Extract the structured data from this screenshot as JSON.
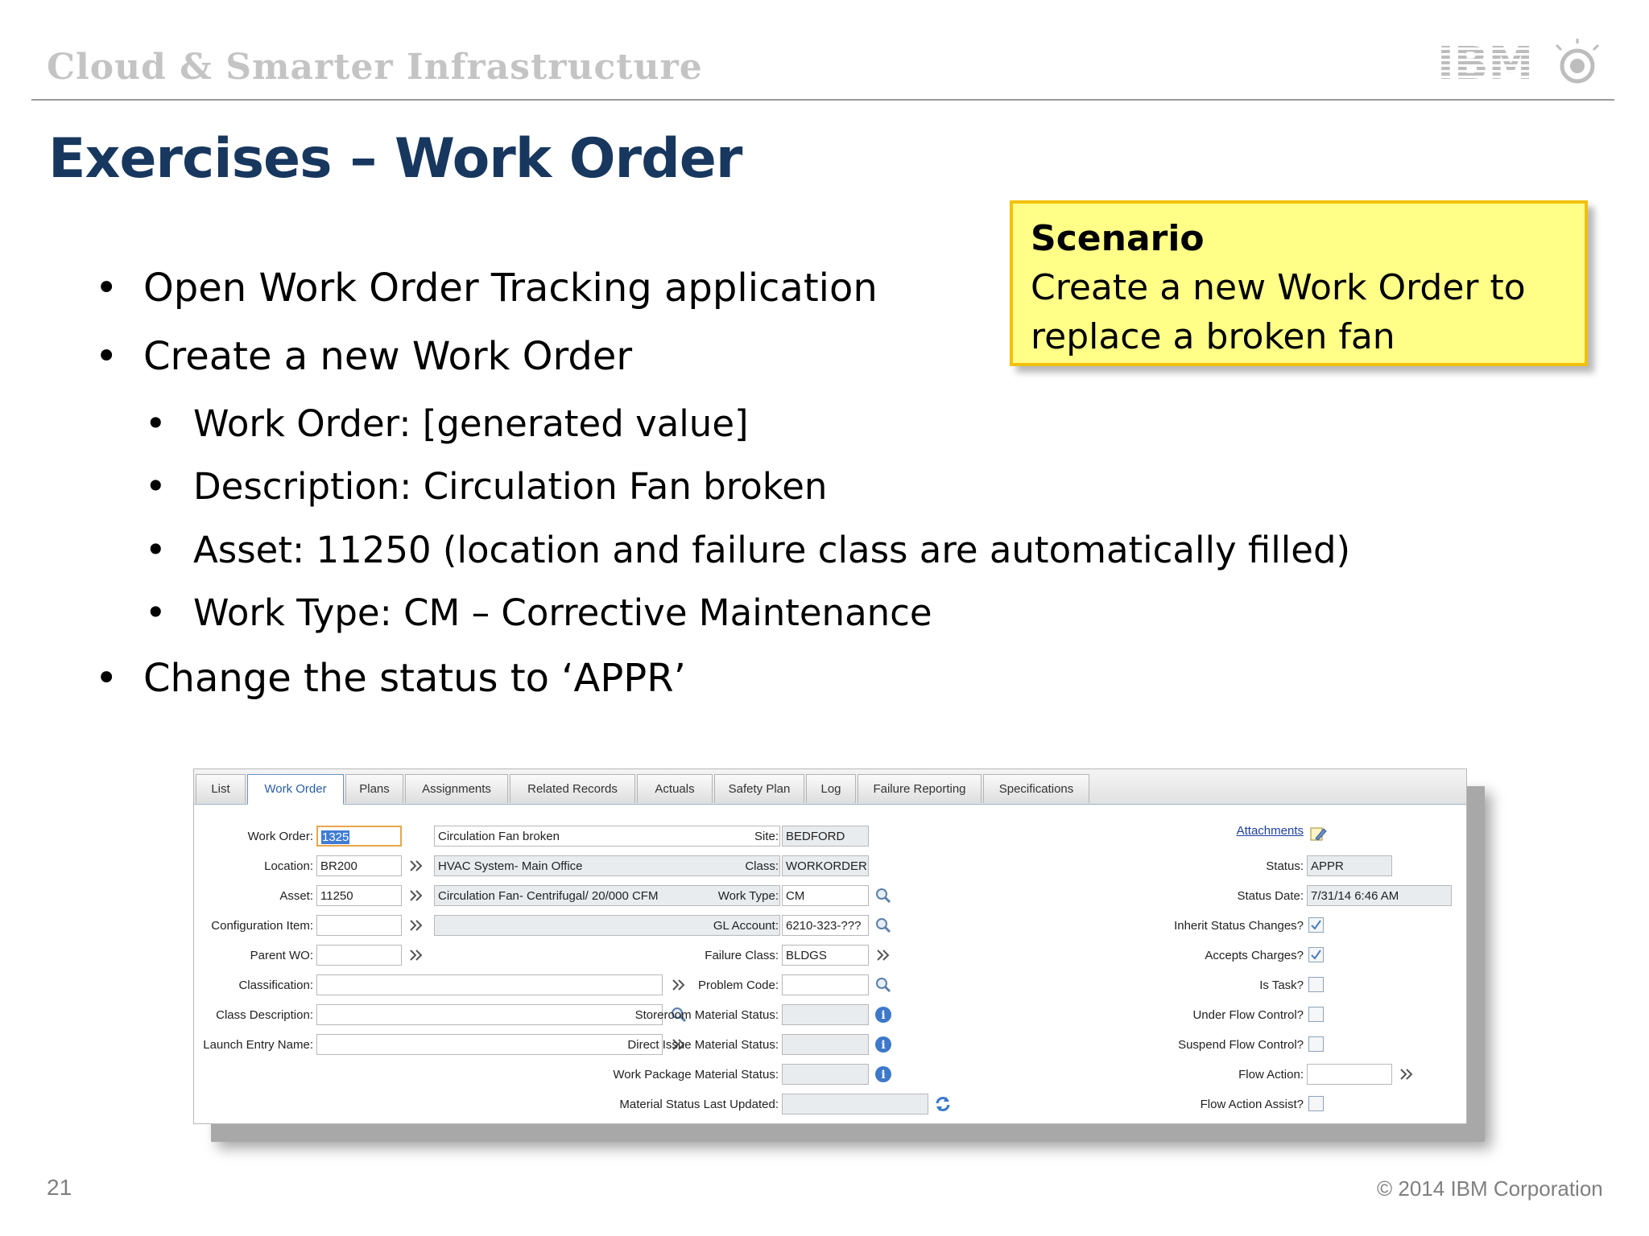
{
  "header": {
    "title": "Cloud & Smarter Infrastructure",
    "logo_text": "IBM"
  },
  "slide": {
    "title": "Exercises – Work Order",
    "bullets": [
      "Open Work Order Tracking application",
      "Create a new Work Order",
      "Work Order: [generated value]",
      "Description: Circulation Fan broken",
      "Asset: 11250 (location and failure class are automatically filled)",
      "Work Type: CM – Corrective Maintenance",
      "Change the status to ‘APPR’"
    ]
  },
  "scenario": {
    "title": "Scenario",
    "line1": "Create a new Work Order to",
    "line2": "replace a broken fan"
  },
  "app": {
    "tabs": [
      "List",
      "Work Order",
      "Plans",
      "Assignments",
      "Related Records",
      "Actuals",
      "Safety Plan",
      "Log",
      "Failure Reporting",
      "Specifications"
    ],
    "active_tab": "Work Order",
    "labels": {
      "work_order": "Work Order:",
      "location": "Location:",
      "asset": "Asset:",
      "configuration_item": "Configuration Item:",
      "parent_wo": "Parent WO:",
      "classification": "Classification:",
      "class_description": "Class Description:",
      "launch_entry_name": "Launch Entry Name:",
      "site": "Site:",
      "class": "Class:",
      "work_type": "Work Type:",
      "gl_account": "GL Account:",
      "failure_class": "Failure Class:",
      "problem_code": "Problem Code:",
      "storeroom_material_status": "Storeroom Material Status:",
      "direct_issue_material_status": "Direct Issue Material Status:",
      "work_package_material_status": "Work Package Material Status:",
      "material_status_last_updated": "Material Status Last Updated:",
      "attachments": "Attachments",
      "status": "Status:",
      "status_date": "Status Date:",
      "inherit_status_changes": "Inherit Status Changes?",
      "accepts_charges": "Accepts Charges?",
      "is_task": "Is Task?",
      "under_flow_control": "Under Flow Control?",
      "suspend_flow_control": "Suspend Flow Control?",
      "flow_action": "Flow Action:",
      "flow_action_assist": "Flow Action Assist?"
    },
    "values": {
      "work_order": "1325",
      "description": "Circulation Fan broken",
      "location": "BR200",
      "location_desc": "HVAC System- Main Office",
      "asset": "11250",
      "asset_desc": "Circulation Fan- Centrifugal/ 20/000 CFM",
      "configuration_item": "",
      "config_desc": "",
      "parent_wo": "",
      "classification": "",
      "class_description": "",
      "launch_entry_name": "",
      "site": "BEDFORD",
      "class": "WORKORDER",
      "work_type": "CM",
      "gl_account": "6210-323-???",
      "failure_class": "BLDGS",
      "problem_code": "",
      "storeroom_material_status": "",
      "direct_issue_material_status": "",
      "work_package_material_status": "",
      "material_status_last_updated": "",
      "status": "APPR",
      "status_date": "7/31/14 6:46 AM",
      "flow_action": "",
      "inherit_status_changes": true,
      "accepts_charges": true,
      "is_task": false,
      "under_flow_control": false,
      "suspend_flow_control": false,
      "flow_action_assist": false
    }
  },
  "footer": {
    "page_number": "21",
    "copyright": "© 2014 IBM Corporation"
  },
  "colors": {
    "title": "#17375e",
    "scenario_bg": "#ffff88",
    "scenario_border": "#f2c00c",
    "header_text": "#c4c4c4"
  }
}
